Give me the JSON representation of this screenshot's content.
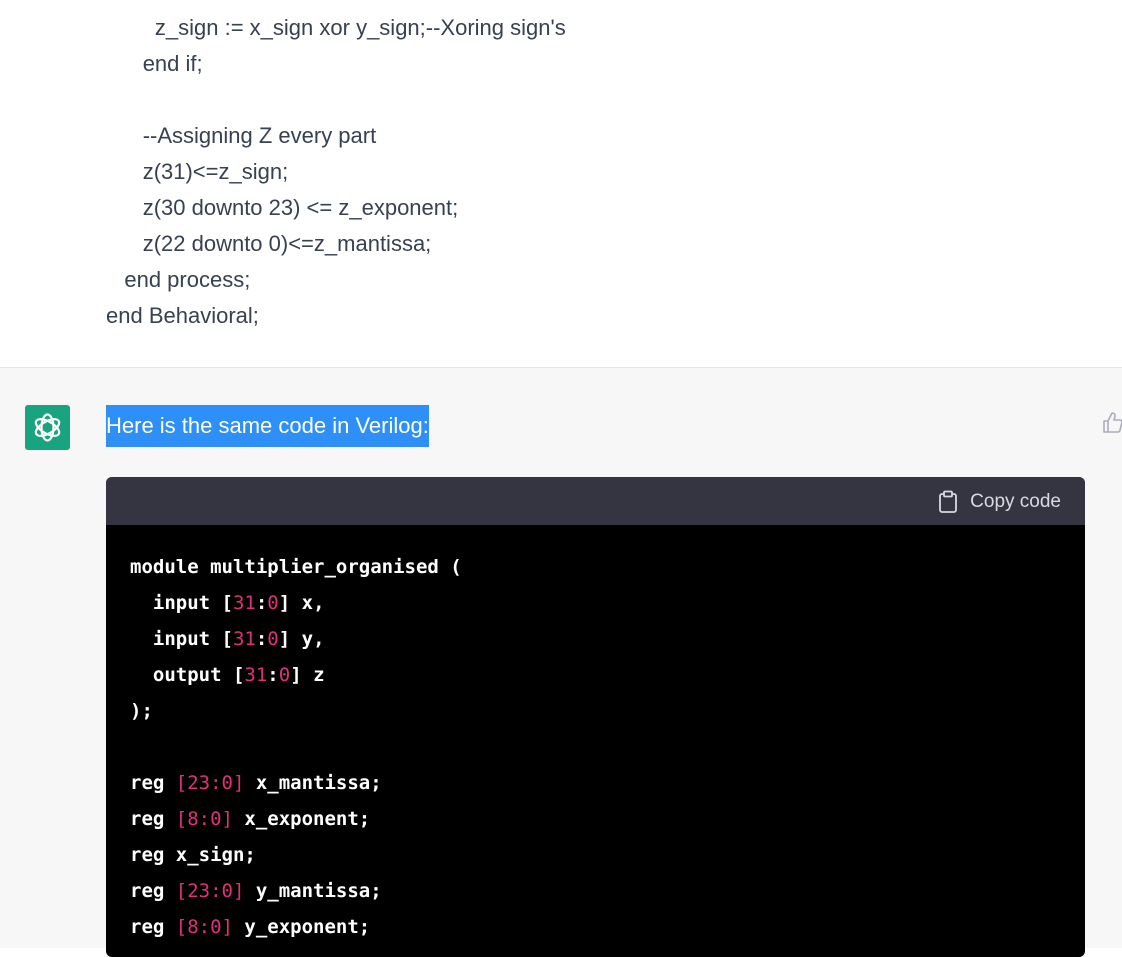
{
  "user_message": {
    "lines": [
      {
        "indent": "        ",
        "text": "z_sign := x_sign xor y_sign;--Xoring sign's"
      },
      {
        "indent": "      ",
        "text": "end if;"
      },
      {
        "indent": "",
        "text": ""
      },
      {
        "indent": "      ",
        "text": "--Assigning Z every part"
      },
      {
        "indent": "      ",
        "text": "z(31)<=z_sign;"
      },
      {
        "indent": "      ",
        "text": "z(30 downto 23) <= z_exponent;"
      },
      {
        "indent": "      ",
        "text": "z(22 downto 0)<=z_mantissa;"
      },
      {
        "indent": "   ",
        "text": "end process;"
      },
      {
        "indent": "",
        "text": "end Behavioral;"
      }
    ]
  },
  "assistant_message": {
    "avatar_icon": "openai-logo-icon",
    "intro_text": "Here is the same code in Verilog:",
    "feedback_icon": "thumbs-up-icon",
    "code_block": {
      "copy_label": "Copy code",
      "copy_icon": "clipboard-icon",
      "lines": [
        {
          "pre": "module multiplier_organised (",
          "num1": "",
          "mid": "",
          "num2": "",
          "post": ""
        },
        {
          "pre": "  input [",
          "num1": "31",
          "mid": ":",
          "num2": "0",
          "post": "] x,"
        },
        {
          "pre": "  input [",
          "num1": "31",
          "mid": ":",
          "num2": "0",
          "post": "] y,"
        },
        {
          "pre": "  output [",
          "num1": "31",
          "mid": ":",
          "num2": "0",
          "post": "] z"
        },
        {
          "pre": ");",
          "num1": "",
          "mid": "",
          "num2": "",
          "post": ""
        },
        {
          "pre": "",
          "num1": "",
          "mid": "",
          "num2": "",
          "post": ""
        },
        {
          "pre": "reg ",
          "num1": "[23:0]",
          "mid": "",
          "num2": "",
          "post": " x_mantissa;"
        },
        {
          "pre": "reg ",
          "num1": "[8:0]",
          "mid": "",
          "num2": "",
          "post": " x_exponent;"
        },
        {
          "pre": "reg x_sign;",
          "num1": "",
          "mid": "",
          "num2": "",
          "post": ""
        },
        {
          "pre": "reg ",
          "num1": "[23:0]",
          "mid": "",
          "num2": "",
          "post": " y_mantissa;"
        },
        {
          "pre": "reg ",
          "num1": "[8:0]",
          "mid": "",
          "num2": "",
          "post": " y_exponent;"
        }
      ]
    }
  },
  "colors": {
    "selection_bg": "#2e8ff7",
    "avatar_bg": "#19a37f",
    "code_bg": "#000000",
    "code_header_bg": "#343541",
    "number_color": "#df3079"
  }
}
